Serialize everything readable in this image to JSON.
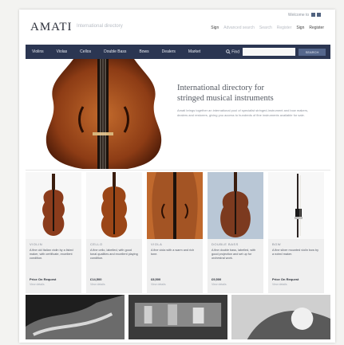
{
  "topbar": {
    "logo": "AMATI",
    "tagline": "International directory",
    "welcome": "Welcome to",
    "links": [
      "Sign",
      "Advanced search",
      "Search",
      "Register",
      "Sign",
      "Register"
    ]
  },
  "nav": {
    "items": [
      "Violins",
      "Violas",
      "Cellos",
      "Double Bass",
      "Bows",
      "Dealers",
      "Market"
    ],
    "find_label": "Find",
    "search_button": "SEARCH"
  },
  "hero": {
    "title_line1": "International directory for",
    "title_line2": "stringed musical instruments",
    "desc": "Amati brings together an international pool of specialist stringed-instrument and bow makers, dealers and restorers, giving you access to hundreds of fine instruments available for sale."
  },
  "cards": [
    {
      "label": "VIOLIN",
      "desc": "A fine old Italian violin by a listed maker, with certificate, excellent condition.",
      "price": "Price On Request",
      "sub": "View details",
      "color": "#8b3c1c"
    },
    {
      "label": "CELLO",
      "desc": "A fine cello, labelled, with good tonal qualities and excellent playing condition.",
      "price": "£14,500",
      "sub": "View details",
      "color": "#9b4617"
    },
    {
      "label": "VIOLA",
      "desc": "A fine viola with a warm and rich tone.",
      "price": "£8,500",
      "sub": "View details",
      "color": "#a35424"
    },
    {
      "label": "DOUBLE BASS",
      "desc": "A fine double bass, labelled, with good projection and set up for orchestral work.",
      "price": "£9,500",
      "sub": "View details",
      "color": "#7c3a1f"
    },
    {
      "label": "BOW",
      "desc": "A fine silver mounted violin bow by a noted maker.",
      "price": "Price On Request",
      "sub": "View details",
      "color": "#2a2220"
    }
  ],
  "colors": {
    "nav_bg": "#2b3652",
    "accent": "#55678c"
  }
}
